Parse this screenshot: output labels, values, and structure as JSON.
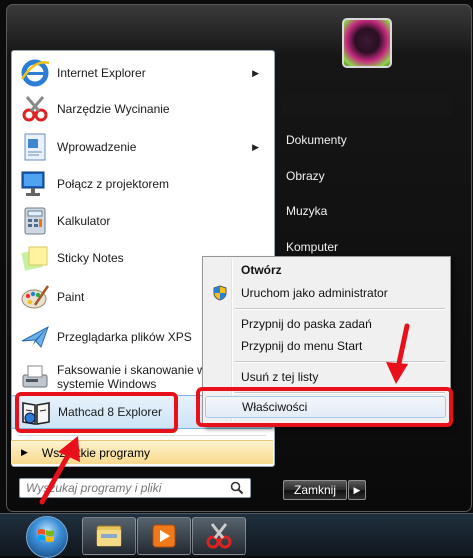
{
  "start_menu": {
    "programs": [
      {
        "label": "Internet Explorer",
        "icon": "internet-explorer-icon",
        "has_submenu": true
      },
      {
        "label": "Narzędzie Wycinanie",
        "icon": "snipping-tool-icon",
        "has_submenu": false
      },
      {
        "label": "Wprowadzenie",
        "icon": "getting-started-icon",
        "has_submenu": true
      },
      {
        "label": "Połącz z projektorem",
        "icon": "projector-icon",
        "has_submenu": false
      },
      {
        "label": "Kalkulator",
        "icon": "calculator-icon",
        "has_submenu": false
      },
      {
        "label": "Sticky Notes",
        "icon": "sticky-notes-icon",
        "has_submenu": false
      },
      {
        "label": "Paint",
        "icon": "paint-icon",
        "has_submenu": false
      },
      {
        "label": "Przeglądarka plików XPS",
        "icon": "xps-viewer-icon",
        "has_submenu": false
      },
      {
        "label": "Faksowanie i skanowanie w systemie Windows",
        "line1": "Faksowanie i skanowanie w",
        "line2": "systemie Windows",
        "icon": "fax-scan-icon",
        "has_submenu": false
      },
      {
        "label": "Mathcad 8 Explorer",
        "icon": "mathcad-icon",
        "has_submenu": false
      }
    ],
    "all_programs_label": "Wszystkie programy",
    "search_placeholder": "Wyszukaj programy i pliki",
    "right_links": [
      "Dokumenty",
      "Obrazy",
      "Muzyka",
      "Komputer"
    ],
    "shutdown_label": "Zamknij"
  },
  "context_menu": {
    "items": [
      {
        "label": "Otwórz",
        "bold": true
      },
      {
        "label": "Uruchom jako administrator",
        "icon": "uac-shield-icon"
      },
      {
        "label": "Przypnij do paska zadań"
      },
      {
        "label": "Przypnij do menu Start"
      },
      {
        "label": "Usuń z tej listy"
      },
      {
        "label": "Właściwości",
        "highlighted": true
      }
    ]
  },
  "colors": {
    "annotation_red": "#e8101a",
    "selection_blue": "#cde4f6",
    "all_programs_bg": "#f8d98c"
  }
}
